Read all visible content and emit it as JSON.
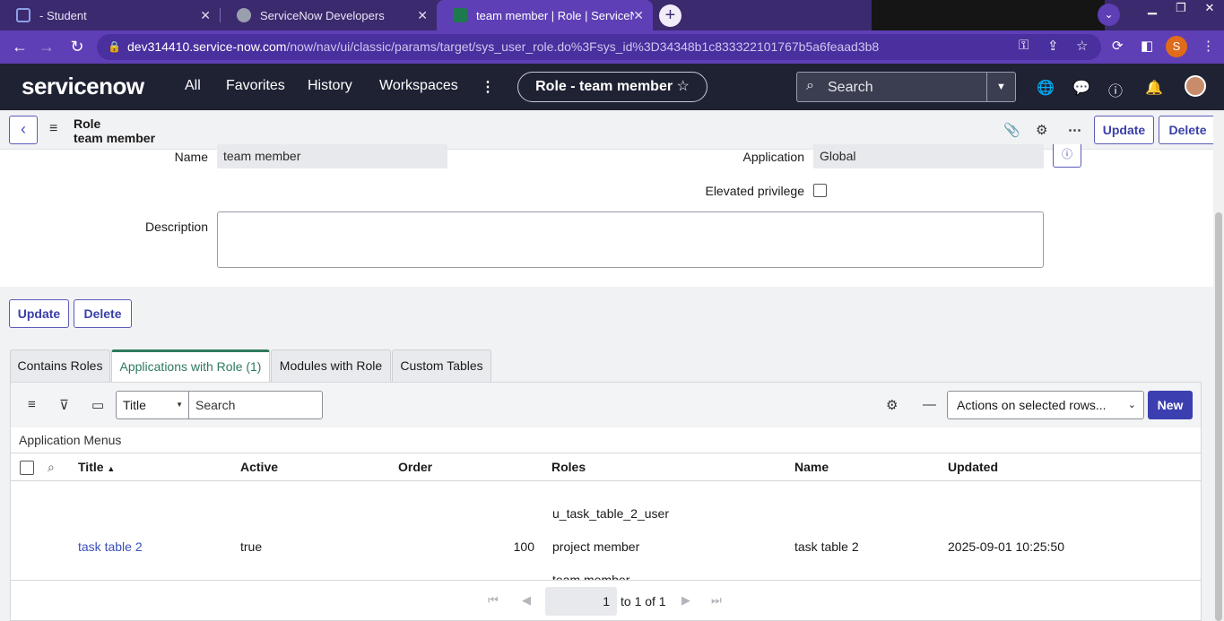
{
  "browser": {
    "tabs": [
      {
        "title": "- Student"
      },
      {
        "title": "ServiceNow Developers"
      },
      {
        "title": "team member | Role | ServiceNow"
      }
    ],
    "url_host": "dev314410.service-now.com",
    "url_path": "/now/nav/ui/classic/params/target/sys_user_role.do%3Fsys_id%3D34348b1c833322101767b5a6feaad3b8",
    "profile_initial": "S"
  },
  "header": {
    "logo": "servicenow",
    "nav": [
      "All",
      "Favorites",
      "History",
      "Workspaces"
    ],
    "context_pill": "Role - team member",
    "search_placeholder": "Search"
  },
  "form": {
    "record_type": "Role",
    "record_name": "team member",
    "buttons": {
      "update": "Update",
      "delete": "Delete"
    },
    "fields": {
      "name_label": "Name",
      "name_value": "team member",
      "application_label": "Application",
      "application_value": "Global",
      "elevated_label": "Elevated privilege",
      "elevated_checked": false,
      "description_label": "Description",
      "description_value": ""
    }
  },
  "related": {
    "buttons": {
      "update": "Update",
      "delete": "Delete"
    },
    "tabs": [
      "Contains Roles",
      "Applications with Role (1)",
      "Modules with Role",
      "Custom Tables"
    ],
    "active_tab": 1,
    "toolbar": {
      "field_select": "Title",
      "search_placeholder": "Search",
      "actions": "Actions on selected rows...",
      "new_label": "New"
    },
    "caption": "Application Menus",
    "columns": [
      "Title",
      "Active",
      "Order",
      "Roles",
      "Name",
      "Updated"
    ],
    "rows": [
      {
        "title": "task table 2",
        "active": "true",
        "order": "100",
        "roles": [
          "u_task_table_2_user",
          "project member",
          "team member"
        ],
        "name": "task table 2",
        "updated": "2025-09-01 10:25:50"
      }
    ],
    "pager": {
      "page": "1",
      "text": "to 1 of 1"
    }
  },
  "colors": {
    "chrome": "#5e3fb5",
    "sn_header": "#1f2233",
    "accent": "#3b3fb0",
    "active_tab": "#2e7a5e"
  }
}
